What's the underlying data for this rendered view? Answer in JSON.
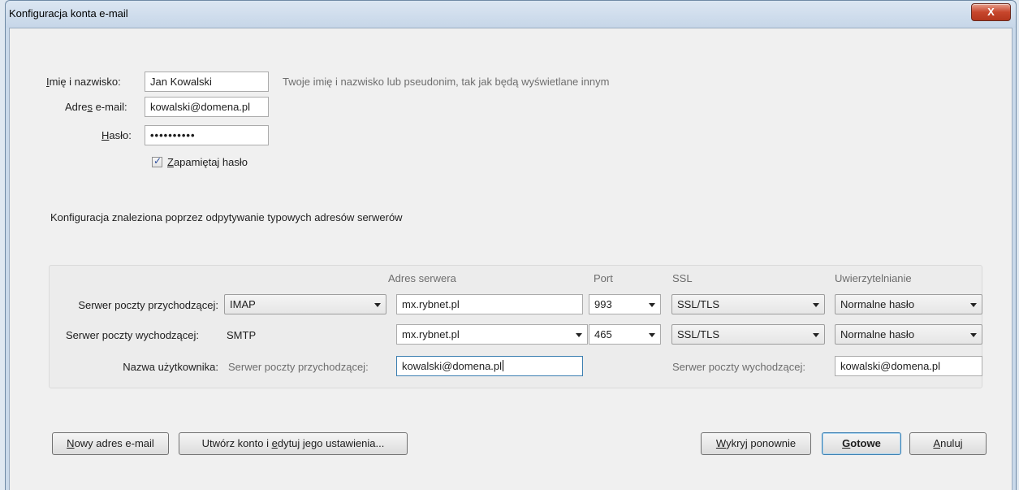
{
  "window": {
    "title": "Konfiguracja konta e-mail",
    "close_label": "X"
  },
  "identity": {
    "name_label_ul": "I",
    "name_label_rest": "mię i nazwisko:",
    "name_value": "Jan Kowalski",
    "name_hint": "Twoje imię i nazwisko lub pseudonim, tak jak będą wyświetlane innym",
    "email_label_pre": "Adre",
    "email_label_ul": "s",
    "email_label_post": " e-mail:",
    "email_value": "kowalski@domena.pl",
    "password_label_ul": "H",
    "password_label_rest": "asło:",
    "password_value": "••••••••••",
    "remember_ul": "Z",
    "remember_rest": "apamiętaj hasło",
    "remember_checked": true
  },
  "status_text": "Konfiguracja znaleziona poprzez odpytywanie typowych adresów serwerów",
  "servers": {
    "headers": {
      "address": "Adres serwera",
      "port": "Port",
      "ssl": "SSL",
      "auth": "Uwierzytelnianie"
    },
    "incoming": {
      "label": "Serwer poczty przychodzącej:",
      "protocol": "IMAP",
      "address": "mx.rybnet.pl",
      "port": "993",
      "ssl": "SSL/TLS",
      "auth": "Normalne hasło"
    },
    "outgoing": {
      "label": "Serwer poczty wychodzącej:",
      "protocol": "SMTP",
      "address": "mx.rybnet.pl",
      "port": "465",
      "ssl": "SSL/TLS",
      "auth": "Normalne hasło"
    },
    "username": {
      "label": "Nazwa użytkownika:",
      "incoming_label": "Serwer poczty przychodzącej:",
      "incoming_value": "kowalski@domena.pl",
      "outgoing_label": "Serwer poczty wychodzącej:",
      "outgoing_value": "kowalski@domena.pl"
    }
  },
  "buttons": {
    "new_email_ul": "N",
    "new_email_rest": "owy adres e-mail",
    "create_pre": "Utwórz konto i ",
    "create_ul": "e",
    "create_post": "dytuj jego ustawienia...",
    "redetect_ul": "W",
    "redetect_rest": "ykryj ponownie",
    "done_ul": "G",
    "done_rest": "otowe",
    "cancel_ul": "A",
    "cancel_rest": "nuluj"
  }
}
